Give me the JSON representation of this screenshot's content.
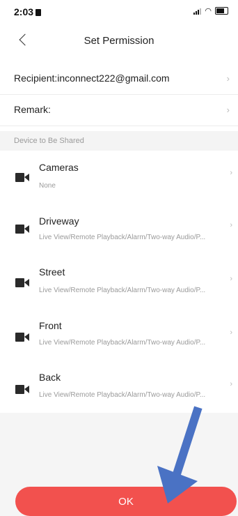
{
  "status_bar": {
    "time": "2:03"
  },
  "header": {
    "title": "Set Permission"
  },
  "recipient": {
    "label": "Recipient:inconnect222@gmail.com"
  },
  "remark": {
    "label": "Remark:"
  },
  "section": {
    "title": "Device to Be Shared"
  },
  "devices": [
    {
      "name": "Cameras",
      "permissions": "None"
    },
    {
      "name": "Driveway",
      "permissions": "Live View/Remote Playback/Alarm/Two-way Audio/P..."
    },
    {
      "name": "Street",
      "permissions": "Live View/Remote Playback/Alarm/Two-way Audio/P..."
    },
    {
      "name": "Front",
      "permissions": "Live View/Remote Playback/Alarm/Two-way Audio/P..."
    },
    {
      "name": "Back",
      "permissions": "Live View/Remote Playback/Alarm/Two-way Audio/P..."
    }
  ],
  "footer": {
    "ok_label": "OK"
  },
  "colors": {
    "accent": "#f2514e",
    "annotation_arrow": "#4a72c4"
  }
}
